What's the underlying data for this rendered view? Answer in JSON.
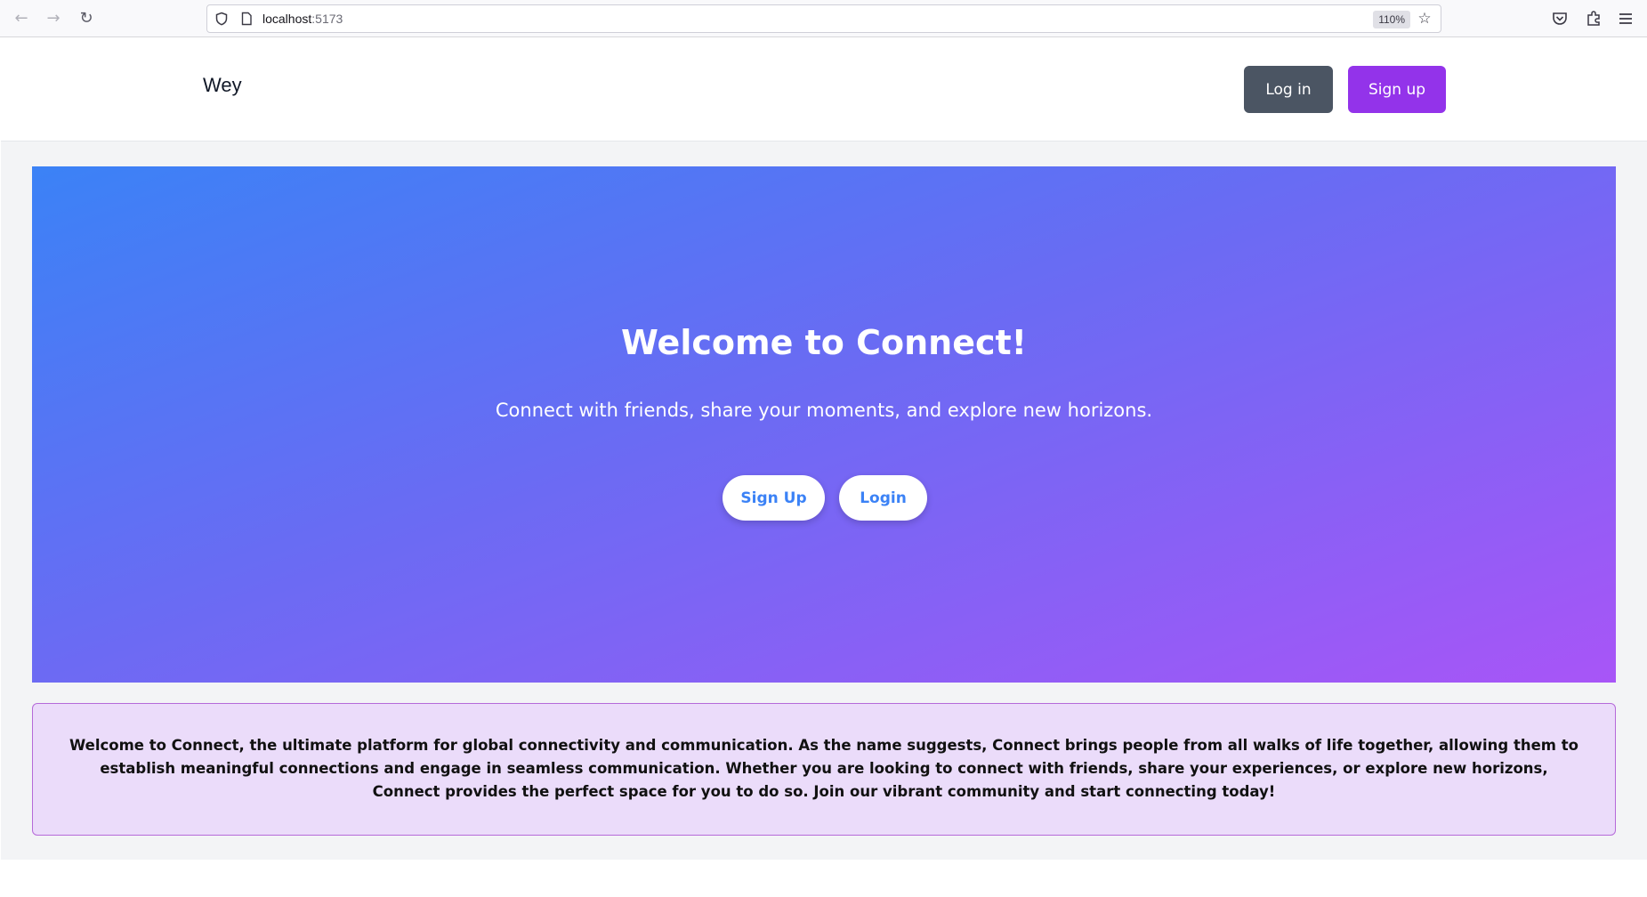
{
  "browser": {
    "url_host": "localhost",
    "url_port": ":5173",
    "zoom": "110%"
  },
  "header": {
    "brand": "Wey",
    "login_label": "Log in",
    "signup_label": "Sign up"
  },
  "hero": {
    "title": "Welcome to Connect!",
    "subtitle": "Connect with friends, share your moments, and explore new horizons.",
    "signup_label": "Sign Up",
    "login_label": "Login"
  },
  "info": {
    "text": "Welcome to Connect, the ultimate platform for global connectivity and communication. As the name suggests, Connect brings people from all walks of life together, allowing them to establish meaningful connections and engage in seamless communication. Whether you are looking to connect with friends, share your experiences, or explore new horizons, Connect provides the perfect space for you to do so. Join our vibrant community and start connecting today!"
  },
  "colors": {
    "header_login_bg": "#4b5563",
    "header_signup_bg": "#9333ea",
    "hero_gradient_start": "#3b82f6",
    "hero_gradient_end": "#a855f7",
    "hero_button_text": "#3b82f6",
    "info_bg": "#ebdcfa",
    "info_border": "#b56ad9"
  },
  "icons": {
    "back": "arrow-left-icon",
    "forward": "arrow-right-icon",
    "reload": "reload-icon",
    "shield": "shield-icon",
    "page": "page-icon",
    "bookmark": "star-icon",
    "pocket": "pocket-icon",
    "extensions": "puzzle-icon",
    "menu": "hamburger-menu-icon"
  }
}
